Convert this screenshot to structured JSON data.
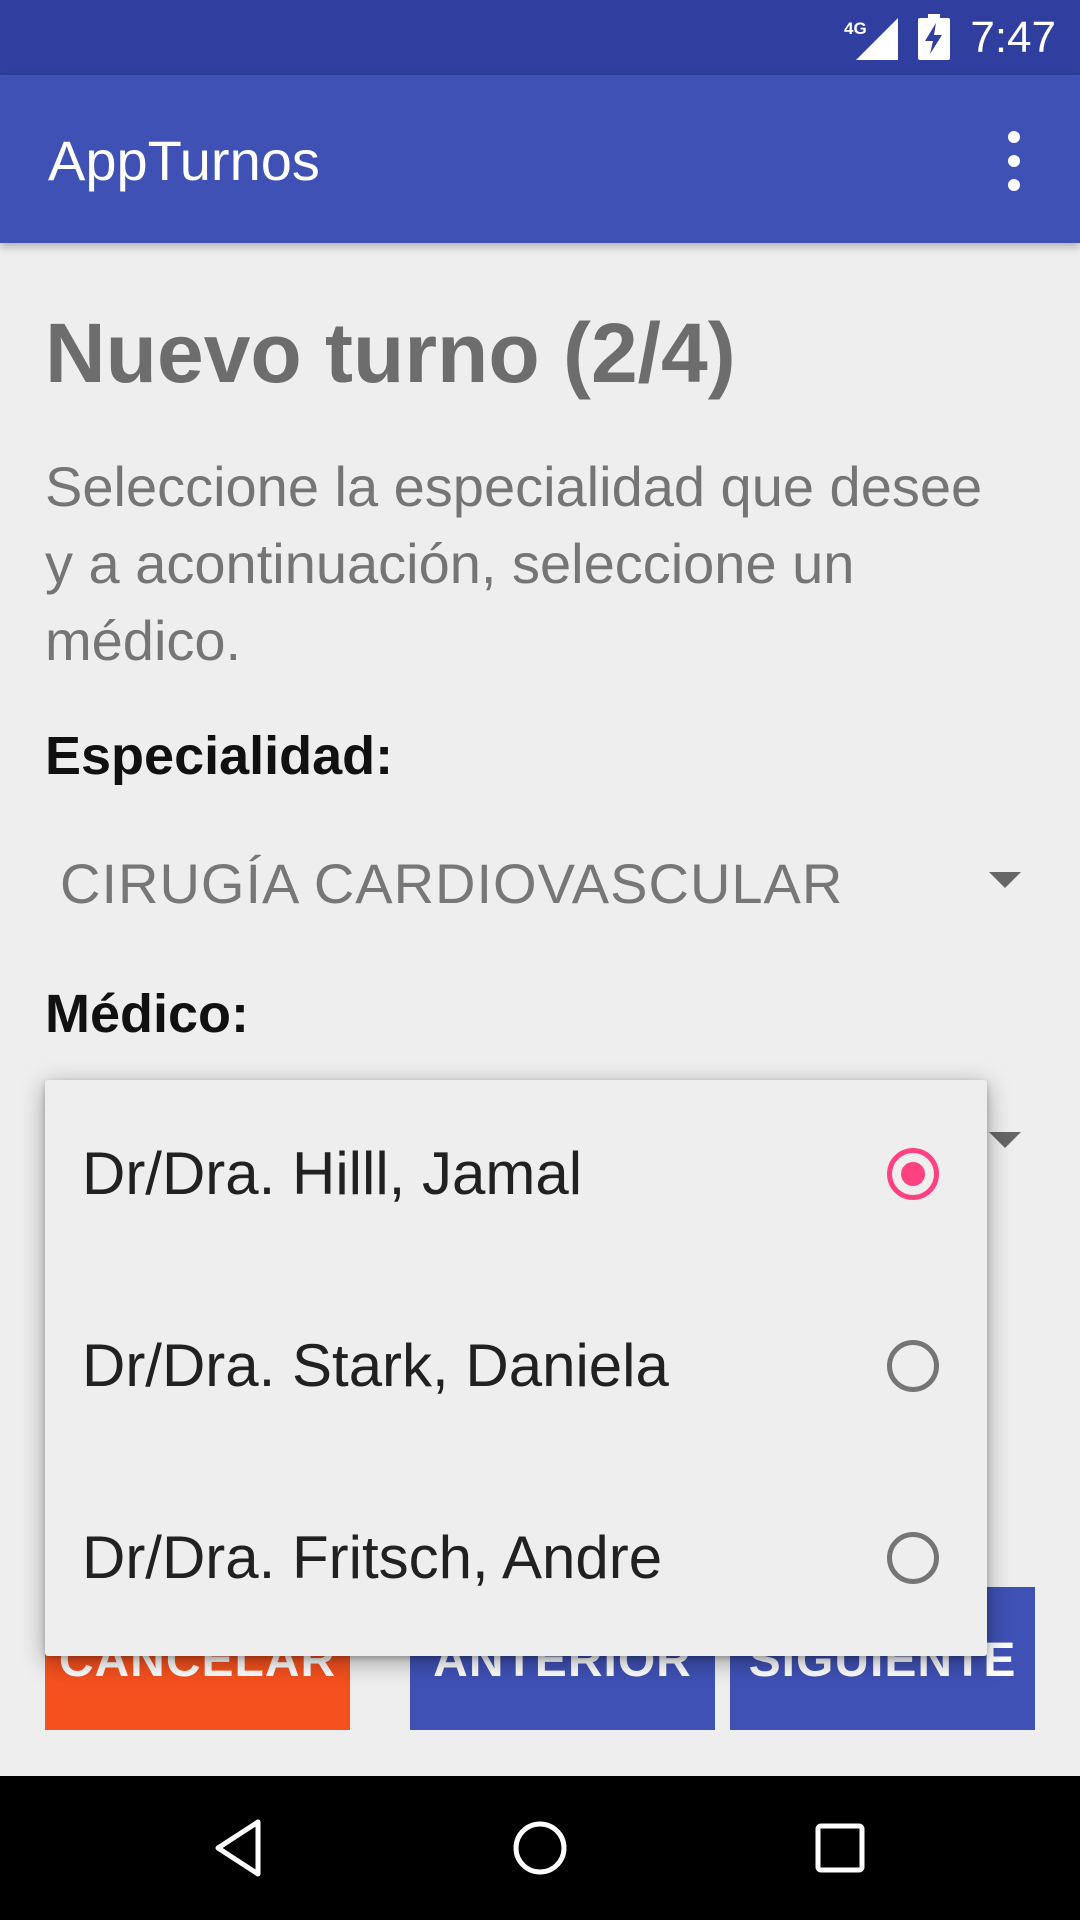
{
  "status_bar": {
    "network": "4G",
    "time": "7:47"
  },
  "app_bar": {
    "title": "AppTurnos",
    "menu_icon": "more-vert-icon"
  },
  "form": {
    "heading": "Nuevo turno (2/4)",
    "instructions": "Seleccione la especialidad que desee y a acontinuación, seleccione un médico.",
    "specialty_label": "Especialidad:",
    "specialty_value": "CIRUGÍA CARDIOVASCULAR",
    "doctor_label": "Médico:"
  },
  "doctor_dropdown": {
    "options": [
      {
        "label": "Dr/Dra. Hilll, Jamal",
        "selected": true
      },
      {
        "label": "Dr/Dra. Stark, Daniela",
        "selected": false
      },
      {
        "label": "Dr/Dra. Fritsch, Andre",
        "selected": false
      }
    ]
  },
  "buttons": {
    "cancel": "CANCELAR",
    "previous": "ANTERIOR",
    "next": "SIGUIENTE"
  },
  "colors": {
    "status_bar": "#303f9f",
    "primary": "#3f51b5",
    "accent": "#ff4081",
    "cancel": "#f4511e"
  },
  "nav_bar": {
    "icons": [
      "back-icon",
      "home-icon",
      "recents-icon"
    ]
  }
}
